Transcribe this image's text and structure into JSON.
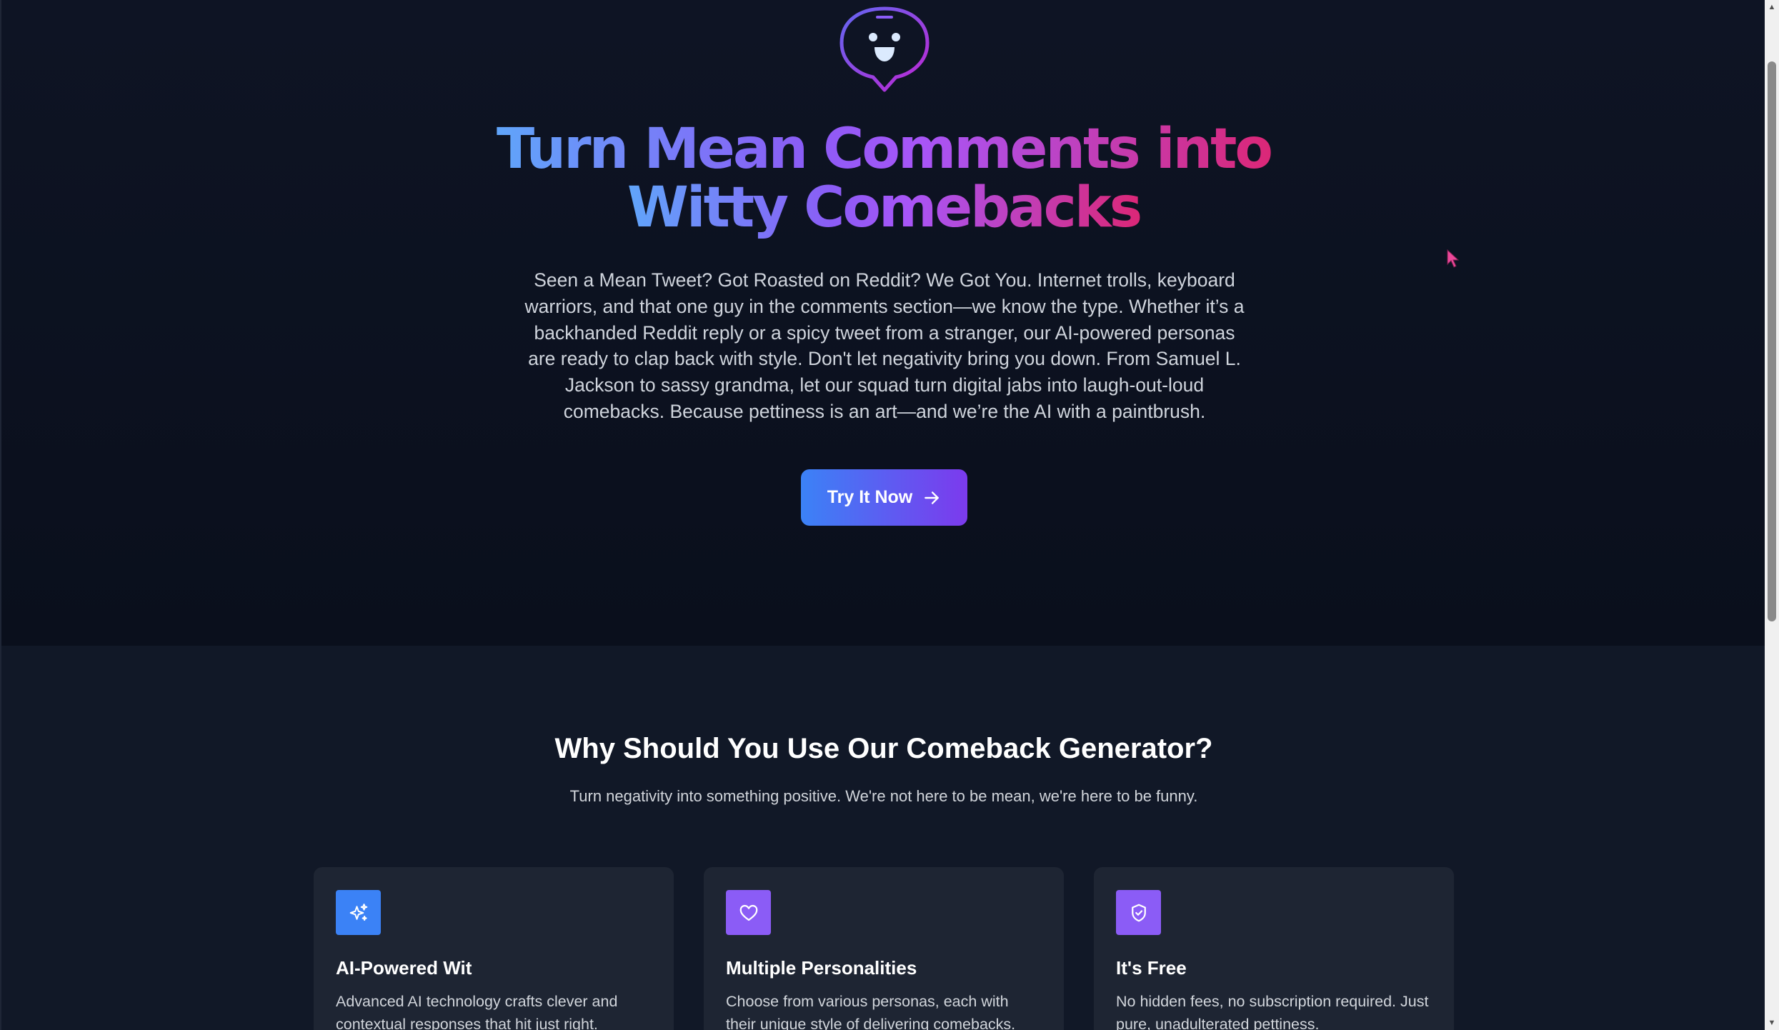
{
  "hero": {
    "headline_line1": "Turn Mean Comments into",
    "headline_line2": "Witty Comebacks",
    "intro": "Seen a Mean Tweet? Got Roasted on Reddit? We Got You. Internet trolls, keyboard warriors, and that one guy in the comments section—we know the type. Whether it’s a backhanded Reddit reply or a spicy tweet from a stranger, our AI-powered personas are ready to clap back with style. Don't let negativity bring you down. From Samuel L. Jackson to sassy grandma, let our squad turn digital jabs into laugh-out-loud comebacks. Because pettiness is an art—and we’re the AI with a paintbrush.",
    "cta_label": "Try It Now",
    "logo_icon": "chat-bubble-smiley-icon",
    "gradient_colors": [
      "#60a5fa",
      "#8b5cf6",
      "#a855f7",
      "#db2777"
    ]
  },
  "features": {
    "title": "Why Should You Use Our Comeback Generator?",
    "subtitle": "Turn negativity into something positive. We're not here to be mean, we're here to be funny.",
    "cards": [
      {
        "icon": "sparkles-icon",
        "icon_color": "#3b82f6",
        "title": "AI-Powered Wit",
        "description": "Advanced AI technology crafts clever and contextual responses that hit just right."
      },
      {
        "icon": "heart-icon",
        "icon_color": "#8b5cf6",
        "title": "Multiple Personalities",
        "description": "Choose from various personas, each with their unique style of delivering comebacks."
      },
      {
        "icon": "shield-check-icon",
        "icon_color": "#8b5cf6",
        "title": "It's Free",
        "description": "No hidden fees, no subscription required. Just pure, unadulterated pettiness."
      }
    ]
  },
  "colors": {
    "hero_bg": "#0e1424",
    "features_bg": "#111827",
    "card_bg": "#1e2533",
    "cta_gradient": [
      "#3b82f6",
      "#7c3aed"
    ],
    "cursor": "#ec4899"
  }
}
